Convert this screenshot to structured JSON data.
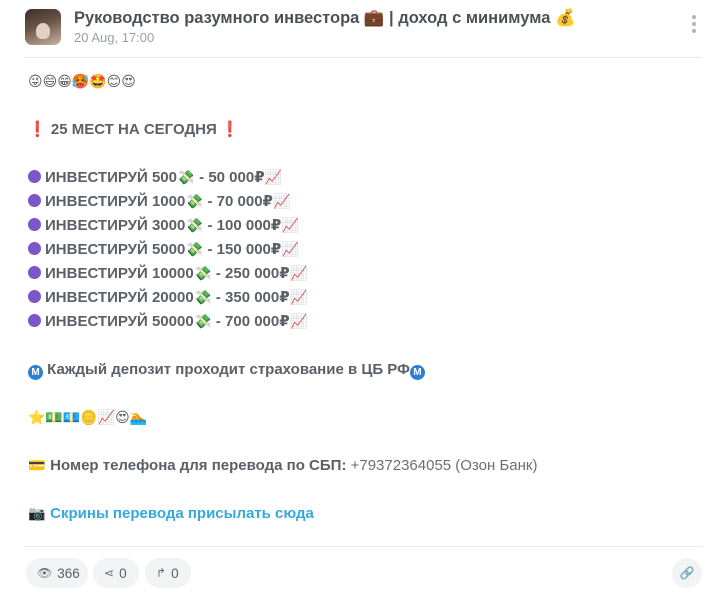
{
  "channel": {
    "title": "Руководство разумного инвестора 💼 | доход с минимума 💰",
    "date": "20 Aug, 17:00"
  },
  "post": {
    "emoji_row_top": "😜😄😁🥵🤩😊😍",
    "headline": "25 МЕСТ НА СЕГОДНЯ",
    "headline_mark": "❗",
    "invest_prefix": "ИНВЕСТИРУЙ",
    "invest_rows": [
      {
        "amount": "500",
        "result": "- 50 000₽"
      },
      {
        "amount": "1000",
        "result": "- 70 000₽"
      },
      {
        "amount": "3000",
        "result": "- 100 000₽"
      },
      {
        "amount": "5000",
        "result": "- 150 000₽"
      },
      {
        "amount": "10000",
        "result": "- 250 000₽"
      },
      {
        "amount": "20000",
        "result": "- 350 000₽"
      },
      {
        "amount": "50000",
        "result": "- 700 000₽"
      }
    ],
    "money_emoji": "💸",
    "chart_emoji": "📈",
    "insurance_text": "Каждый депозит проходит страхование в ЦБ РФ",
    "metro_letter": "M",
    "emoji_row_mid": "⭐💵💶🪙📈😍🏊",
    "phone_label": "Номер телефона для перевода по СБП:",
    "phone_value": "+79372364055 (Озон Банк)",
    "card_emoji": "💳",
    "camera_emoji": "📷",
    "screens_link": "Скрины перевода присылать сюда"
  },
  "footer": {
    "views": "366",
    "shares": "0",
    "forwards": "0",
    "icons": {
      "views": "eye-icon",
      "shares": "share-icon",
      "forwards": "forward-icon",
      "link": "link-icon"
    }
  },
  "colors": {
    "accent_link": "#34aadc",
    "dot": "#7b57c9",
    "metro": "#2b7fd6",
    "text": "#5b6068"
  }
}
